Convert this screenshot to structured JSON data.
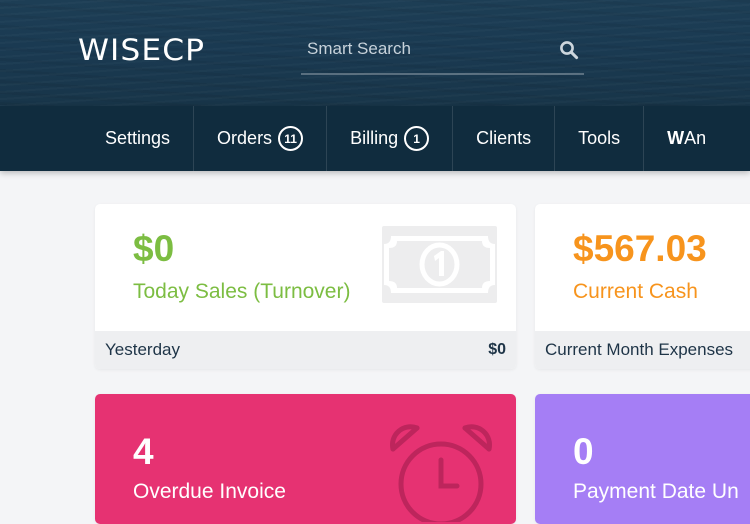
{
  "header": {
    "logo": "WISECP",
    "search": {
      "placeholder": "Smart Search",
      "value": ""
    }
  },
  "nav": {
    "items": [
      {
        "label": "Settings"
      },
      {
        "label": "Orders",
        "badge": "11"
      },
      {
        "label": "Billing",
        "badge": "1"
      },
      {
        "label": "Clients"
      },
      {
        "label": "Tools"
      },
      {
        "label_bold": "W",
        "label_rest": "An"
      }
    ]
  },
  "cards": {
    "today_sales": {
      "value": "$0",
      "label": "Today Sales (Turnover)",
      "footer_label": "Yesterday",
      "footer_value": "$0",
      "color": "#7cbd42",
      "icon": "money-bill-icon"
    },
    "current_cash": {
      "value": "$567.03",
      "label": "Current Cash",
      "footer_label": "Current Month Expenses",
      "color": "#f7941d"
    },
    "overdue_invoice": {
      "value": "4",
      "label": "Overdue Invoice",
      "color": "#e63272",
      "icon": "alarm-clock-icon"
    },
    "payment_date": {
      "value": "0",
      "label": "Payment Date Un",
      "color": "#a57ef5"
    }
  }
}
